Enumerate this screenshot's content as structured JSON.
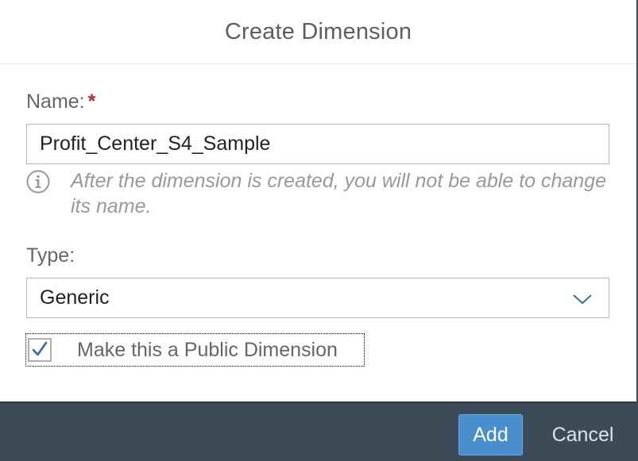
{
  "dialog": {
    "title": "Create Dimension"
  },
  "name_field": {
    "label": "Name:",
    "required_marker": "*",
    "value": "Profit_Center_S4_Sample",
    "info_icon": "info-icon",
    "info_text": "After the dimension is created, you will not be able to change its name."
  },
  "type_field": {
    "label": "Type:",
    "selected": "Generic",
    "dropdown_icon": "chevron-down-icon"
  },
  "public_checkbox": {
    "label": "Make this a Public Dimension",
    "checked": true,
    "check_color": "#2b6cb0"
  },
  "footer": {
    "add_label": "Add",
    "cancel_label": "Cancel",
    "background": "#3d4a57",
    "accent": "#4a8fcd"
  }
}
